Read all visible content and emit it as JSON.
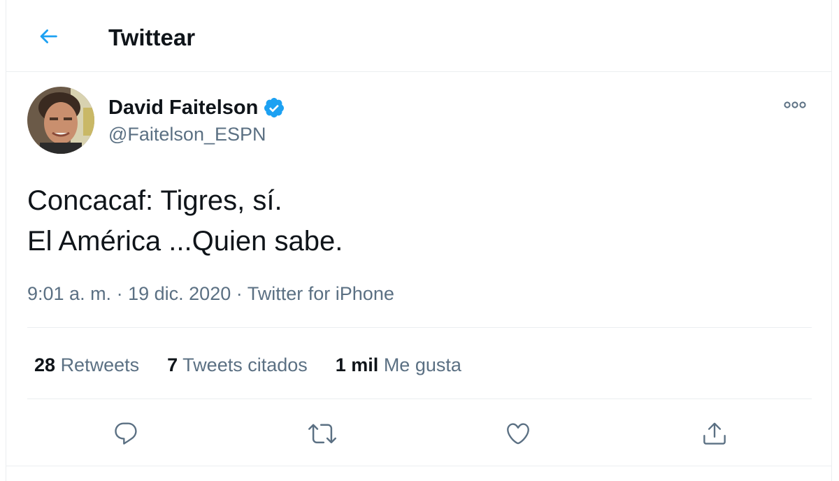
{
  "header": {
    "title": "Twittear",
    "back_icon": "arrow-left-icon"
  },
  "tweet": {
    "author": {
      "name": "David Faitelson",
      "handle": "@Faitelson_ESPN",
      "verified": true,
      "verified_icon": "verified-badge-icon"
    },
    "text": "Concacaf: Tigres, sí.\nEl América ...Quien sabe.",
    "time": "9:01 a. m.",
    "date": "19 dic. 2020",
    "separator": "·",
    "source": "Twitter for iPhone",
    "stats": {
      "retweets_count": "28",
      "retweets_label": "Retweets",
      "quotes_count": "7",
      "quotes_label": "Tweets citados",
      "likes_count": "1 mil",
      "likes_label": "Me gusta"
    }
  },
  "actions": {
    "reply_icon": "reply-icon",
    "retweet_icon": "retweet-icon",
    "like_icon": "heart-icon",
    "share_icon": "share-icon"
  },
  "colors": {
    "accent": "#1da1f2",
    "text_primary": "#0f1419",
    "text_secondary": "#5b7083",
    "border": "#ebeef0"
  }
}
